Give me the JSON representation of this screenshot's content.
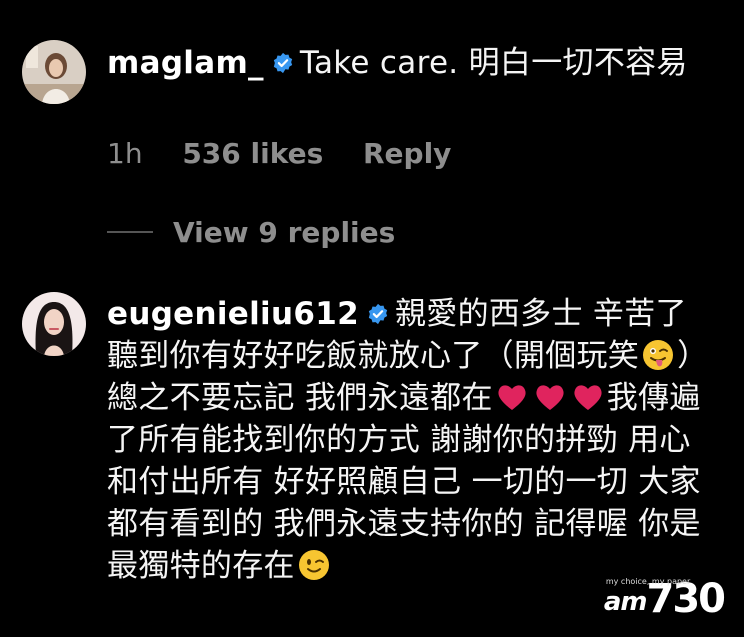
{
  "comments": [
    {
      "username": "maglam_",
      "text": "Take care. 明白一切不容易",
      "time": "1h",
      "likes": "536 likes",
      "reply_label": "Reply",
      "avatar_icon": "profile-photo-woman-light"
    },
    {
      "username": "eugenieliu612",
      "text_part1": "親愛的西多士 辛苦了 聽到你有好好吃飯就放心了（開個玩笑",
      "emoji1": "winking-face-with-tongue",
      "text_part2": "）總之不要忘記 我們永遠都在",
      "hearts": [
        "red-heart",
        "red-heart",
        "red-heart"
      ],
      "text_part3": "我傳遍了所有能找到你的方式 謝謝你的拼勁 用心 和付出所有 好好照顧自己 一切的一切 大家都有看到的 我們永遠支持你的 記得喔 你是最獨特的存在",
      "emoji2": "winking-face",
      "avatar_icon": "profile-photo-woman-dark-hair"
    }
  ],
  "view_replies": "View 9 replies",
  "watermark": {
    "small": "my choice, my paper",
    "brand": "am",
    "number": "730"
  },
  "colors": {
    "background": "#000000",
    "text": "#f5f5f5",
    "meta": "#8e8e8e",
    "verified": "#3897f0",
    "heart": "#e0245e"
  }
}
